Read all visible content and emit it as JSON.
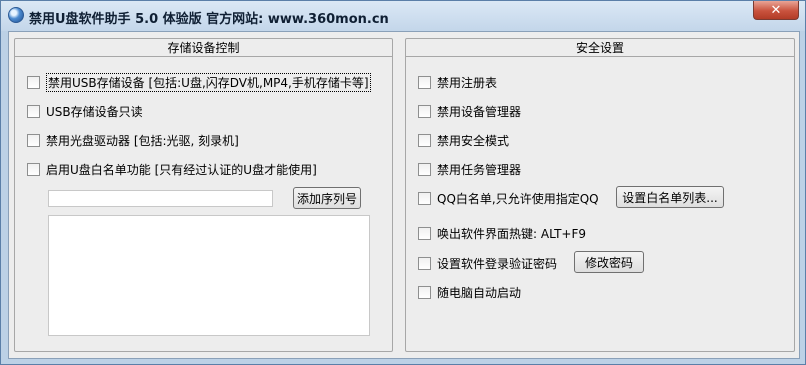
{
  "window": {
    "title": "禁用U盘软件助手 5.0 体验版  官方网站: www.360mon.cn",
    "close_label": "✕"
  },
  "storage_panel": {
    "title": "存储设备控制",
    "options": [
      {
        "label": "禁用USB存储设备 [包括:U盘,闪存DV机,MP4,手机存储卡等]",
        "checked": false
      },
      {
        "label": "USB存储设备只读",
        "checked": false
      },
      {
        "label": "禁用光盘驱动器 [包括:光驱, 刻录机]",
        "checked": false
      },
      {
        "label": "启用U盘白名单功能 [只有经过认证的U盘才能使用]",
        "checked": false
      }
    ],
    "serial_input_value": "",
    "add_serial_label": "添加序列号"
  },
  "security_panel": {
    "title": "安全设置",
    "options": [
      {
        "label": "禁用注册表",
        "checked": false
      },
      {
        "label": "禁用设备管理器",
        "checked": false
      },
      {
        "label": "禁用安全模式",
        "checked": false
      },
      {
        "label": "禁用任务管理器",
        "checked": false
      },
      {
        "label": "QQ白名单,只允许使用指定QQ",
        "checked": false
      },
      {
        "label": "唤出软件界面热键: ALT+F9",
        "checked": false
      },
      {
        "label": "设置软件登录验证密码",
        "checked": false
      },
      {
        "label": "随电脑自动启动",
        "checked": false
      }
    ],
    "set_whitelist_label": "设置白名单列表...",
    "change_password_label": "修改密码"
  }
}
